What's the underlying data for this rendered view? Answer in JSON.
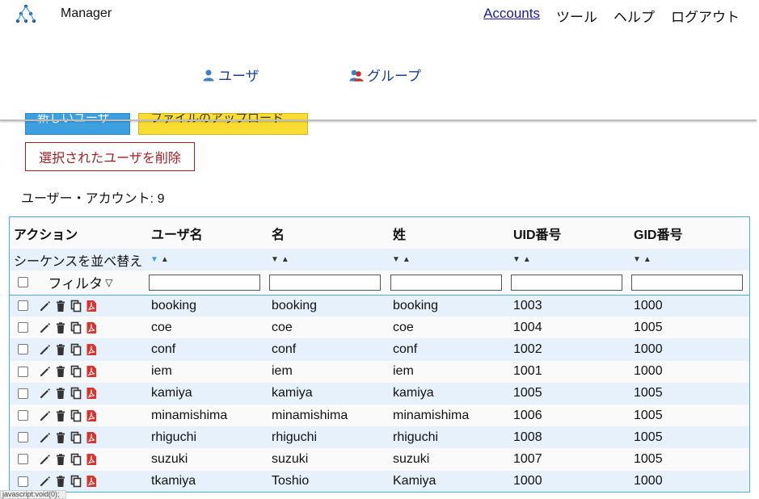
{
  "header": {
    "app_title": "Manager",
    "nav": [
      {
        "label": "Accounts"
      },
      {
        "label": "ツール"
      },
      {
        "label": "ヘルプ"
      },
      {
        "label": "ログアウト"
      }
    ],
    "accent": "#1a1a9c"
  },
  "subnav": {
    "users_label": "ユーザ",
    "groups_label": "グループ"
  },
  "buttons": {
    "new_user": "新しいユーザ",
    "file_upload": "ファイルのアップロード",
    "delete_selected": "選択されたユーザを削除"
  },
  "account_count": "ユーザー・アカウント: 9",
  "table": {
    "headers": [
      "アクション",
      "ユーザ名",
      "名",
      "姓",
      "UID番号",
      "GID番号"
    ],
    "sort_label": "シーケンスを並べ替え",
    "filter_label": "フィルタ",
    "rows": [
      {
        "username": "booking",
        "first": "booking",
        "last": "booking",
        "uid": "1003",
        "gid": "1000"
      },
      {
        "username": "coe",
        "first": "coe",
        "last": "coe",
        "uid": "1004",
        "gid": "1005"
      },
      {
        "username": "conf",
        "first": "conf",
        "last": "conf",
        "uid": "1002",
        "gid": "1000"
      },
      {
        "username": "iem",
        "first": "iem",
        "last": "iem",
        "uid": "1001",
        "gid": "1000"
      },
      {
        "username": "kamiya",
        "first": "kamiya",
        "last": "kamiya",
        "uid": "1005",
        "gid": "1005"
      },
      {
        "username": "minamishima",
        "first": "minamishima",
        "last": "minamishima",
        "uid": "1006",
        "gid": "1005"
      },
      {
        "username": "rhiguchi",
        "first": "rhiguchi",
        "last": "rhiguchi",
        "uid": "1008",
        "gid": "1005"
      },
      {
        "username": "suzuki",
        "first": "suzuki",
        "last": "suzuki",
        "uid": "1007",
        "gid": "1005"
      },
      {
        "username": "tkamiya",
        "first": "Toshio",
        "last": "Kamiya",
        "uid": "1000",
        "gid": "1000"
      }
    ],
    "row_action_icons": [
      "pencil-icon",
      "trash-icon",
      "copy-icon",
      "pdf-icon"
    ]
  },
  "statusbar_text": "javascript:void(0);"
}
